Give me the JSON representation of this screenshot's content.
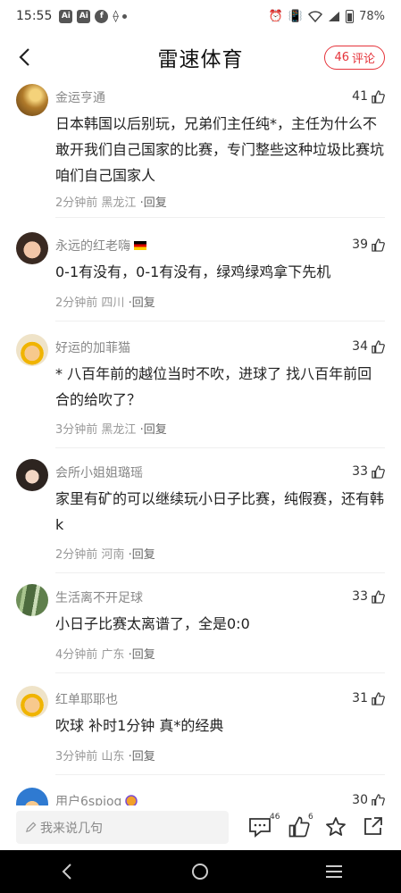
{
  "status_bar": {
    "time": "15:55",
    "left_icons": [
      "ai-icon",
      "ai-icon",
      "facebook-icon",
      "vpn-icon"
    ],
    "ai_label": "Ai",
    "battery": "78%"
  },
  "header": {
    "title": "雷速体育",
    "comment_count": "46",
    "comment_label": "评论"
  },
  "comments": [
    {
      "username": "金运亨通",
      "likes": "41",
      "text": "日本韩国以后别玩，兄弟们主任纯*，主任为什么不敢开我们自己国家的比赛，专门整些这种垃圾比赛坑咱们自己国家人",
      "time": "2分钟前",
      "location": "黑龙江",
      "reply": "·回复",
      "avatar": "gold-coin-avatar"
    },
    {
      "username": "永远的红老嗨",
      "flag": "germany-flag",
      "likes": "39",
      "text": "0-1有没有，0-1有没有，绿鸡绿鸡拿下先机",
      "time": "2分钟前",
      "location": "四川",
      "reply": "·回复",
      "avatar": "kid-avatar"
    },
    {
      "username": "好运的加菲猫",
      "likes": "34",
      "text": "* 八百年前的越位当时不吹，进球了 找八百年前回合的给吹了？",
      "time": "3分钟前",
      "location": "黑龙江",
      "reply": "·回复",
      "avatar": "cartoon-worker-avatar"
    },
    {
      "username": "会所小姐姐璐瑶",
      "likes": "33",
      "text": "家里有矿的可以继续玩小日子比赛，纯假赛，还有韩k",
      "time": "2分钟前",
      "location": "河南",
      "reply": "·回复",
      "avatar": "girl-avatar"
    },
    {
      "username": "生活离不开足球",
      "likes": "33",
      "text": "小日子比赛太离谱了，全是0:0",
      "time": "4分钟前",
      "location": "广东",
      "reply": "·回复",
      "avatar": "bamboo-avatar"
    },
    {
      "username": "红单耶耶也",
      "likes": "31",
      "text": "吹球 补时1分钟 真*的经典",
      "time": "3分钟前",
      "location": "山东",
      "reply": "·回复",
      "avatar": "cartoon-worker-avatar"
    },
    {
      "username": "用户6spiog",
      "likes": "30",
      "text": "",
      "time": "",
      "location": "",
      "reply": "",
      "avatar": "blue-cartoon-avatar"
    }
  ],
  "bottom_bar": {
    "input_placeholder": "我来说几句",
    "comment_badge": "46",
    "like_badge": "6"
  },
  "colors": {
    "accent": "#e5333a",
    "text_primary": "#222222",
    "text_muted": "#999999",
    "nav_background": "#000000"
  }
}
